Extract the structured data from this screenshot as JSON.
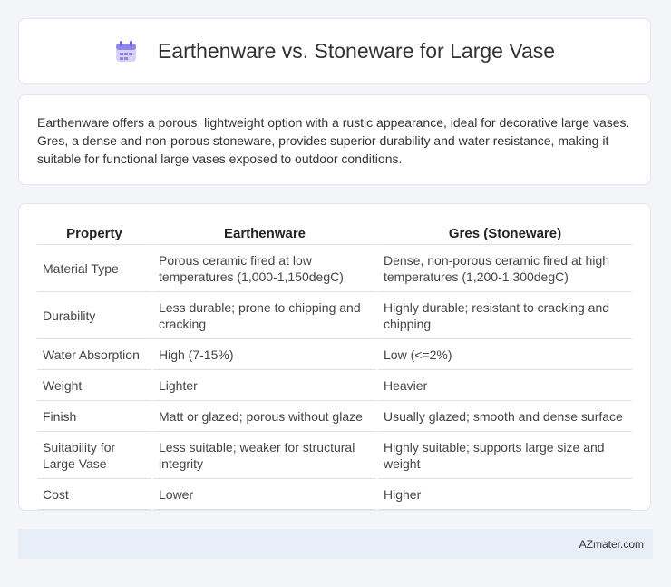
{
  "header": {
    "title": "Earthenware vs. Stoneware for Large Vase",
    "icon": "calendar-icon"
  },
  "intro": "Earthenware offers a porous, lightweight option with a rustic appearance, ideal for decorative large vases. Gres, a dense and non-porous stoneware, provides superior durability and water resistance, making it suitable for functional large vases exposed to outdoor conditions.",
  "table": {
    "headers": [
      "Property",
      "Earthenware",
      "Gres (Stoneware)"
    ],
    "rows": [
      [
        "Material Type",
        "Porous ceramic fired at low temperatures (1,000-1,150degC)",
        "Dense, non-porous ceramic fired at high temperatures (1,200-1,300degC)"
      ],
      [
        "Durability",
        "Less durable; prone to chipping and cracking",
        "Highly durable; resistant to cracking and chipping"
      ],
      [
        "Water Absorption",
        "High (7-15%)",
        "Low (<=2%)"
      ],
      [
        "Weight",
        "Lighter",
        "Heavier"
      ],
      [
        "Finish",
        "Matt or glazed; porous without glaze",
        "Usually glazed; smooth and dense surface"
      ],
      [
        "Suitability for Large Vase",
        "Less suitable; weaker for structural integrity",
        "Highly suitable; supports large size and weight"
      ],
      [
        "Cost",
        "Lower",
        "Higher"
      ]
    ]
  },
  "footer": {
    "brand": "AZmater.com"
  }
}
